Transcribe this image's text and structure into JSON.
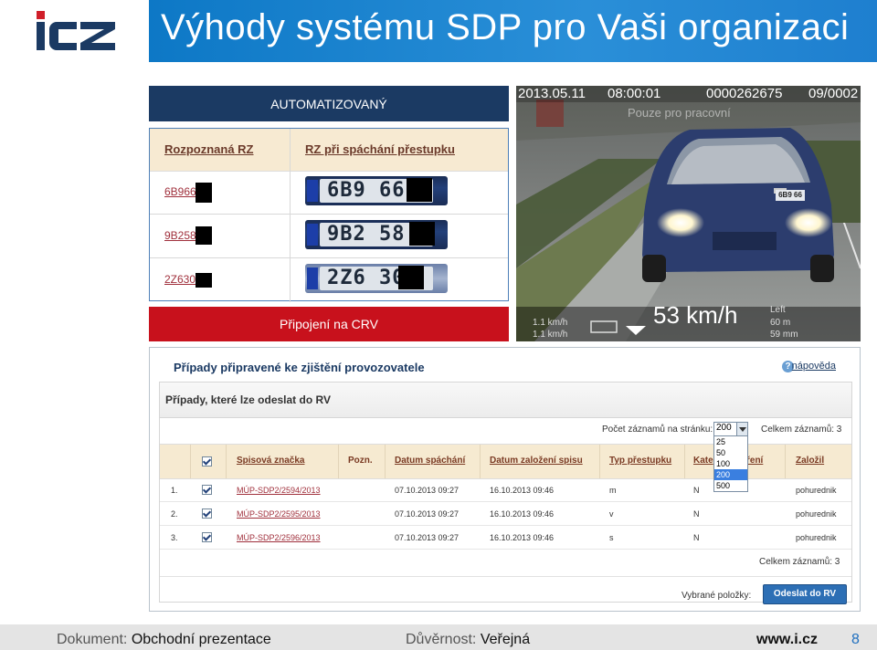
{
  "slide": {
    "title": "Výhody systému SDP pro Vaši organizaci",
    "logo_text": "ICZ",
    "title_bar_color": "#1a83cf"
  },
  "left_column": {
    "auto_banner": "AUTOMATIZOVANÝ",
    "table": {
      "headers": [
        "Rozpoznaná RZ",
        "RZ při spáchání přestupku"
      ],
      "rows": [
        {
          "code": "6B966",
          "plate_text": "6B9 66"
        },
        {
          "code": "9B258",
          "plate_text": "9B2 58"
        },
        {
          "code": "2Z630",
          "plate_text": "2Z6 30"
        }
      ]
    },
    "crv_banner": "Připojení na CRV"
  },
  "photo": {
    "date": "2013.05.11",
    "time": "08:00:01",
    "record_id": "0000262675",
    "frame": "09/0002",
    "watermark": "Pouze pro pracovní",
    "speed": "53 km/h",
    "lane": "Left",
    "distance": "60 m",
    "focal": "59 mm",
    "limit_1": "1.1 km/h",
    "limit_2": "1.1 km/h",
    "small_plate": "6B9 66"
  },
  "app": {
    "title": "Případy připravené ke zjištění provozovatele",
    "help_label": "nápověda",
    "panel_title": "Případy, které lze odeslat do RV",
    "page_size_label": "Počet záznamů na stránku:",
    "page_size_value": "200",
    "page_size_options": [
      "25",
      "50",
      "100",
      "200",
      "500"
    ],
    "total_label": "Celkem záznamů: 3",
    "columns": [
      "Spisová značka",
      "Pozn.",
      "Datum spáchání",
      "Datum založení spisu",
      "Typ přestupku",
      "Kate",
      "ření",
      "Založil"
    ],
    "rows": [
      {
        "num": "1.",
        "id": "MÚP-SDP2/2594/2013",
        "committed": "07.10.2013 09:27",
        "created": "16.10.2013 09:46",
        "type": "m",
        "cat": "N",
        "author": "pohurednik"
      },
      {
        "num": "2.",
        "id": "MÚP-SDP2/2595/2013",
        "committed": "07.10.2013 09:27",
        "created": "16.10.2013 09:46",
        "type": "v",
        "cat": "N",
        "author": "pohurednik"
      },
      {
        "num": "3.",
        "id": "MÚP-SDP2/2596/2013",
        "committed": "07.10.2013 09:27",
        "created": "16.10.2013 09:46",
        "type": "s",
        "cat": "N",
        "author": "pohurednik"
      }
    ],
    "selected_label": "Vybrané položky:",
    "send_button": "Odeslat do RV"
  },
  "footer": {
    "doc_label": "Dokument:",
    "doc_value": "Obchodní prezentace",
    "conf_label": "Důvěrnost:",
    "conf_value": "Veřejná",
    "site": "www.i.cz",
    "page": "8"
  }
}
